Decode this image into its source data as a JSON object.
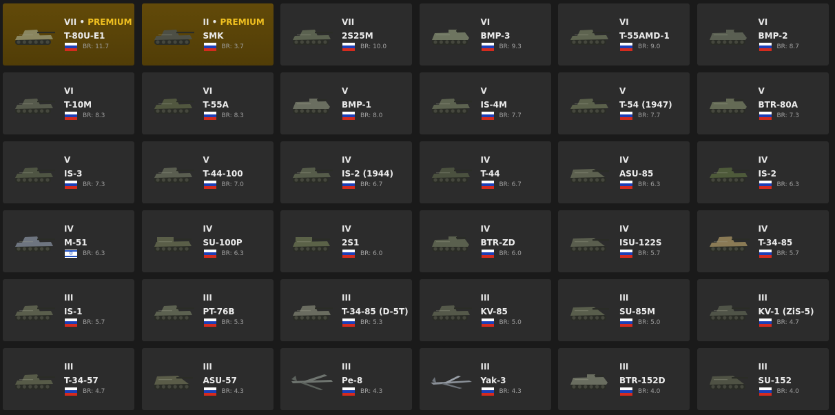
{
  "colors": {
    "background": "#1a1a1a",
    "card": "#2c2c2c",
    "premium_card": "#5a4408",
    "premium_text": "#f0c020"
  },
  "br_prefix": "BR:",
  "premium_separator": " • ",
  "premium_label": "PREMIUM",
  "vehicles": [
    {
      "tier": "VII",
      "premium": true,
      "name": "T-80U-E1",
      "nation": "ru",
      "br": "11.7",
      "icon": "tank-icon",
      "tone": "#8a8660"
    },
    {
      "tier": "II",
      "premium": true,
      "name": "SMK",
      "nation": "ru",
      "br": "3.7",
      "icon": "tank-icon",
      "tone": "#4d4f45"
    },
    {
      "tier": "VII",
      "premium": false,
      "name": "2S25M",
      "nation": "ru",
      "br": "10.0",
      "icon": "light-tank-icon",
      "tone": "#5b6250"
    },
    {
      "tier": "VI",
      "premium": false,
      "name": "BMP-3",
      "nation": "ru",
      "br": "9.3",
      "icon": "ifv-icon",
      "tone": "#6e7560"
    },
    {
      "tier": "VI",
      "premium": false,
      "name": "T-55AMD-1",
      "nation": "ru",
      "br": "9.0",
      "icon": "tank-icon",
      "tone": "#5e6450"
    },
    {
      "tier": "VI",
      "premium": false,
      "name": "BMP-2",
      "nation": "ru",
      "br": "8.7",
      "icon": "ifv-icon",
      "tone": "#5a5f52"
    },
    {
      "tier": "VI",
      "premium": false,
      "name": "T-10M",
      "nation": "ru",
      "br": "8.3",
      "icon": "tank-icon",
      "tone": "#565a4c"
    },
    {
      "tier": "VI",
      "premium": false,
      "name": "T-55A",
      "nation": "ru",
      "br": "8.3",
      "icon": "tank-icon",
      "tone": "#51573f"
    },
    {
      "tier": "V",
      "premium": false,
      "name": "BMP-1",
      "nation": "ru",
      "br": "8.0",
      "icon": "ifv-icon",
      "tone": "#6a6e60"
    },
    {
      "tier": "V",
      "premium": false,
      "name": "IS-4M",
      "nation": "ru",
      "br": "7.7",
      "icon": "tank-icon",
      "tone": "#5d6350"
    },
    {
      "tier": "V",
      "premium": false,
      "name": "T-54 (1947)",
      "nation": "ru",
      "br": "7.7",
      "icon": "tank-icon",
      "tone": "#5b614b"
    },
    {
      "tier": "V",
      "premium": false,
      "name": "BTR-80A",
      "nation": "ru",
      "br": "7.3",
      "icon": "apc-icon",
      "tone": "#646a55"
    },
    {
      "tier": "V",
      "premium": false,
      "name": "IS-3",
      "nation": "ru",
      "br": "7.3",
      "icon": "tank-icon",
      "tone": "#4f5543"
    },
    {
      "tier": "V",
      "premium": false,
      "name": "T-44-100",
      "nation": "ru",
      "br": "7.0",
      "icon": "tank-icon",
      "tone": "#5a5e50"
    },
    {
      "tier": "IV",
      "premium": false,
      "name": "IS-2 (1944)",
      "nation": "ru",
      "br": "6.7",
      "icon": "tank-icon",
      "tone": "#565c4a"
    },
    {
      "tier": "IV",
      "premium": false,
      "name": "T-44",
      "nation": "ru",
      "br": "6.7",
      "icon": "tank-icon",
      "tone": "#4b513f"
    },
    {
      "tier": "IV",
      "premium": false,
      "name": "ASU-85",
      "nation": "ru",
      "br": "6.3",
      "icon": "tank-destroyer-icon",
      "tone": "#5d6150"
    },
    {
      "tier": "IV",
      "premium": false,
      "name": "IS-2",
      "nation": "ru",
      "br": "6.3",
      "icon": "tank-icon",
      "tone": "#4e5a3a"
    },
    {
      "tier": "IV",
      "premium": false,
      "name": "M-51",
      "nation": "il",
      "br": "6.3",
      "icon": "tank-icon",
      "tone": "#6e7580"
    },
    {
      "tier": "IV",
      "premium": false,
      "name": "SU-100P",
      "nation": "ru",
      "br": "6.3",
      "icon": "spg-icon",
      "tone": "#5a5e48"
    },
    {
      "tier": "IV",
      "premium": false,
      "name": "2S1",
      "nation": "ru",
      "br": "6.0",
      "icon": "spg-icon",
      "tone": "#5b6248"
    },
    {
      "tier": "IV",
      "premium": false,
      "name": "BTR-ZD",
      "nation": "ru",
      "br": "6.0",
      "icon": "apc-icon",
      "tone": "#5a604e"
    },
    {
      "tier": "IV",
      "premium": false,
      "name": "ISU-122S",
      "nation": "ru",
      "br": "5.7",
      "icon": "tank-destroyer-icon",
      "tone": "#5a5e4e"
    },
    {
      "tier": "IV",
      "premium": false,
      "name": "T-34-85",
      "nation": "ru",
      "br": "5.7",
      "icon": "tank-icon",
      "tone": "#8a7a55"
    },
    {
      "tier": "III",
      "premium": false,
      "name": "IS-1",
      "nation": "ru",
      "br": "5.7",
      "icon": "tank-icon",
      "tone": "#5a5e4c"
    },
    {
      "tier": "III",
      "premium": false,
      "name": "PT-76B",
      "nation": "ru",
      "br": "5.3",
      "icon": "light-tank-icon",
      "tone": "#5c6150"
    },
    {
      "tier": "III",
      "premium": false,
      "name": "T-34-85 (D-5T)",
      "nation": "ru",
      "br": "5.3",
      "icon": "tank-icon",
      "tone": "#6a6c60"
    },
    {
      "tier": "III",
      "premium": false,
      "name": "KV-85",
      "nation": "ru",
      "br": "5.0",
      "icon": "tank-icon",
      "tone": "#55594a"
    },
    {
      "tier": "III",
      "premium": false,
      "name": "SU-85M",
      "nation": "ru",
      "br": "5.0",
      "icon": "tank-destroyer-icon",
      "tone": "#595e4c"
    },
    {
      "tier": "III",
      "premium": false,
      "name": "KV-1 (ZiS-5)",
      "nation": "ru",
      "br": "4.7",
      "icon": "tank-icon",
      "tone": "#505448"
    },
    {
      "tier": "III",
      "premium": false,
      "name": "T-34-57",
      "nation": "ru",
      "br": "4.7",
      "icon": "tank-icon",
      "tone": "#575b48"
    },
    {
      "tier": "III",
      "premium": false,
      "name": "ASU-57",
      "nation": "ru",
      "br": "4.3",
      "icon": "tank-destroyer-icon",
      "tone": "#5a5c48"
    },
    {
      "tier": "III",
      "premium": false,
      "name": "Pe-8",
      "nation": "ru",
      "br": "4.3",
      "icon": "bomber-icon",
      "tone": "#6f7570"
    },
    {
      "tier": "III",
      "premium": false,
      "name": "Yak-3",
      "nation": "ru",
      "br": "4.3",
      "icon": "fighter-icon",
      "tone": "#8a9098"
    },
    {
      "tier": "III",
      "premium": false,
      "name": "BTR-152D",
      "nation": "ru",
      "br": "4.0",
      "icon": "apc-icon",
      "tone": "#6a6e60"
    },
    {
      "tier": "III",
      "premium": false,
      "name": "SU-152",
      "nation": "ru",
      "br": "4.0",
      "icon": "tank-destroyer-icon",
      "tone": "#4f5244"
    }
  ]
}
